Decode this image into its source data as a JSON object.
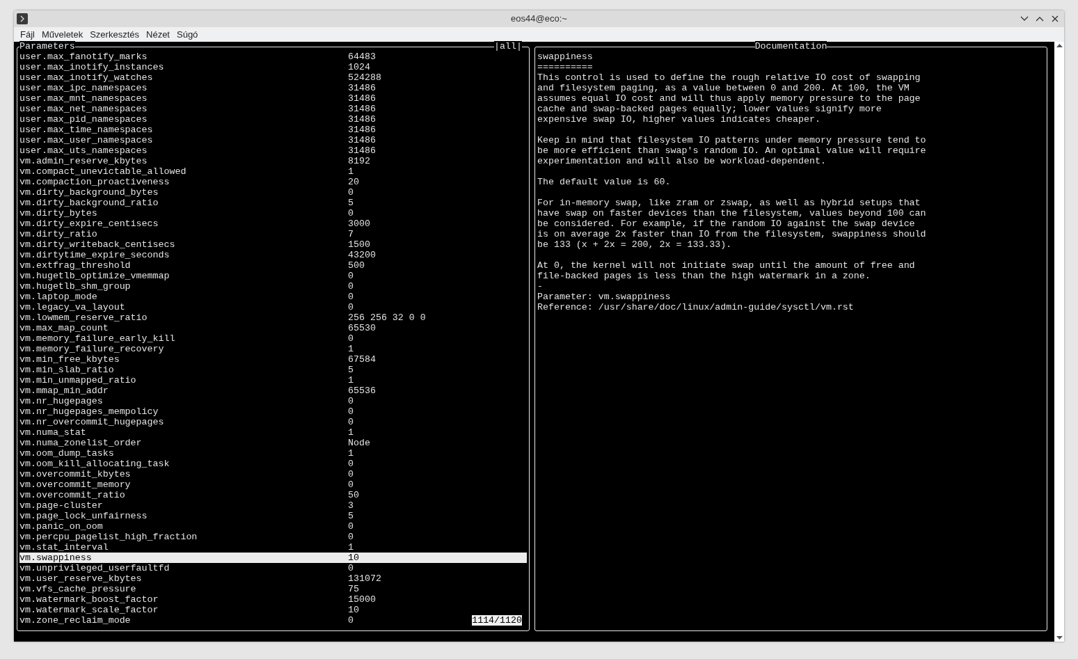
{
  "window": {
    "title": "eos44@eco:~"
  },
  "menu": [
    "Fájl",
    "Műveletek",
    "Szerkesztés",
    "Nézet",
    "Súgó"
  ],
  "parameters_panel": {
    "title": "Parameters",
    "filter": "|all|",
    "counter": "1114/1120",
    "rows": [
      {
        "name": "user.max_fanotify_marks",
        "value": "64483",
        "selected": false
      },
      {
        "name": "user.max_inotify_instances",
        "value": "1024",
        "selected": false
      },
      {
        "name": "user.max_inotify_watches",
        "value": "524288",
        "selected": false
      },
      {
        "name": "user.max_ipc_namespaces",
        "value": "31486",
        "selected": false
      },
      {
        "name": "user.max_mnt_namespaces",
        "value": "31486",
        "selected": false
      },
      {
        "name": "user.max_net_namespaces",
        "value": "31486",
        "selected": false
      },
      {
        "name": "user.max_pid_namespaces",
        "value": "31486",
        "selected": false
      },
      {
        "name": "user.max_time_namespaces",
        "value": "31486",
        "selected": false
      },
      {
        "name": "user.max_user_namespaces",
        "value": "31486",
        "selected": false
      },
      {
        "name": "user.max_uts_namespaces",
        "value": "31486",
        "selected": false
      },
      {
        "name": "vm.admin_reserve_kbytes",
        "value": "8192",
        "selected": false
      },
      {
        "name": "vm.compact_unevictable_allowed",
        "value": "1",
        "selected": false
      },
      {
        "name": "vm.compaction_proactiveness",
        "value": "20",
        "selected": false
      },
      {
        "name": "vm.dirty_background_bytes",
        "value": "0",
        "selected": false
      },
      {
        "name": "vm.dirty_background_ratio",
        "value": "5",
        "selected": false
      },
      {
        "name": "vm.dirty_bytes",
        "value": "0",
        "selected": false
      },
      {
        "name": "vm.dirty_expire_centisecs",
        "value": "3000",
        "selected": false
      },
      {
        "name": "vm.dirty_ratio",
        "value": "7",
        "selected": false
      },
      {
        "name": "vm.dirty_writeback_centisecs",
        "value": "1500",
        "selected": false
      },
      {
        "name": "vm.dirtytime_expire_seconds",
        "value": "43200",
        "selected": false
      },
      {
        "name": "vm.extfrag_threshold",
        "value": "500",
        "selected": false
      },
      {
        "name": "vm.hugetlb_optimize_vmemmap",
        "value": "0",
        "selected": false
      },
      {
        "name": "vm.hugetlb_shm_group",
        "value": "0",
        "selected": false
      },
      {
        "name": "vm.laptop_mode",
        "value": "0",
        "selected": false
      },
      {
        "name": "vm.legacy_va_layout",
        "value": "0",
        "selected": false
      },
      {
        "name": "vm.lowmem_reserve_ratio",
        "value": "256 256 32 0 0",
        "selected": false
      },
      {
        "name": "vm.max_map_count",
        "value": "65530",
        "selected": false
      },
      {
        "name": "vm.memory_failure_early_kill",
        "value": "0",
        "selected": false
      },
      {
        "name": "vm.memory_failure_recovery",
        "value": "1",
        "selected": false
      },
      {
        "name": "vm.min_free_kbytes",
        "value": "67584",
        "selected": false
      },
      {
        "name": "vm.min_slab_ratio",
        "value": "5",
        "selected": false
      },
      {
        "name": "vm.min_unmapped_ratio",
        "value": "1",
        "selected": false
      },
      {
        "name": "vm.mmap_min_addr",
        "value": "65536",
        "selected": false
      },
      {
        "name": "vm.nr_hugepages",
        "value": "0",
        "selected": false
      },
      {
        "name": "vm.nr_hugepages_mempolicy",
        "value": "0",
        "selected": false
      },
      {
        "name": "vm.nr_overcommit_hugepages",
        "value": "0",
        "selected": false
      },
      {
        "name": "vm.numa_stat",
        "value": "1",
        "selected": false
      },
      {
        "name": "vm.numa_zonelist_order",
        "value": "Node",
        "selected": false
      },
      {
        "name": "vm.oom_dump_tasks",
        "value": "1",
        "selected": false
      },
      {
        "name": "vm.oom_kill_allocating_task",
        "value": "0",
        "selected": false
      },
      {
        "name": "vm.overcommit_kbytes",
        "value": "0",
        "selected": false
      },
      {
        "name": "vm.overcommit_memory",
        "value": "0",
        "selected": false
      },
      {
        "name": "vm.overcommit_ratio",
        "value": "50",
        "selected": false
      },
      {
        "name": "vm.page-cluster",
        "value": "3",
        "selected": false
      },
      {
        "name": "vm.page_lock_unfairness",
        "value": "5",
        "selected": false
      },
      {
        "name": "vm.panic_on_oom",
        "value": "0",
        "selected": false
      },
      {
        "name": "vm.percpu_pagelist_high_fraction",
        "value": "0",
        "selected": false
      },
      {
        "name": "vm.stat_interval",
        "value": "1",
        "selected": false
      },
      {
        "name": "vm.swappiness",
        "value": "10",
        "selected": true
      },
      {
        "name": "vm.unprivileged_userfaultfd",
        "value": "0",
        "selected": false
      },
      {
        "name": "vm.user_reserve_kbytes",
        "value": "131072",
        "selected": false
      },
      {
        "name": "vm.vfs_cache_pressure",
        "value": "75",
        "selected": false
      },
      {
        "name": "vm.watermark_boost_factor",
        "value": "15000",
        "selected": false
      },
      {
        "name": "vm.watermark_scale_factor",
        "value": "10",
        "selected": false
      },
      {
        "name": "vm.zone_reclaim_mode",
        "value": "0",
        "selected": false
      }
    ]
  },
  "documentation_panel": {
    "title": "Documentation",
    "paragraphs": [
      [
        "swappiness",
        "==========",
        "This control is used to define the rough relative IO cost of swapping",
        "and filesystem paging, as a value between 0 and 200. At 100, the VM",
        "assumes equal IO cost and will thus apply memory pressure to the page",
        "cache and swap-backed pages equally; lower values signify more",
        "expensive swap IO, higher values indicates cheaper."
      ],
      [
        "Keep in mind that filesystem IO patterns under memory pressure tend to",
        "be more efficient than swap's random IO. An optimal value will require",
        "experimentation and will also be workload-dependent."
      ],
      [
        "The default value is 60."
      ],
      [
        "For in-memory swap, like zram or zswap, as well as hybrid setups that",
        "have swap on faster devices than the filesystem, values beyond 100 can",
        "be considered. For example, if the random IO against the swap device",
        "is on average 2x faster than IO from the filesystem, swappiness should",
        "be 133 (x + 2x = 200, 2x = 133.33)."
      ],
      [
        "At 0, the kernel will not initiate swap until the amount of free and",
        "file-backed pages is less than the high watermark in a zone.",
        "-",
        "Parameter: vm.swappiness",
        "Reference: /usr/share/doc/linux/admin-guide/sysctl/vm.rst"
      ]
    ]
  }
}
